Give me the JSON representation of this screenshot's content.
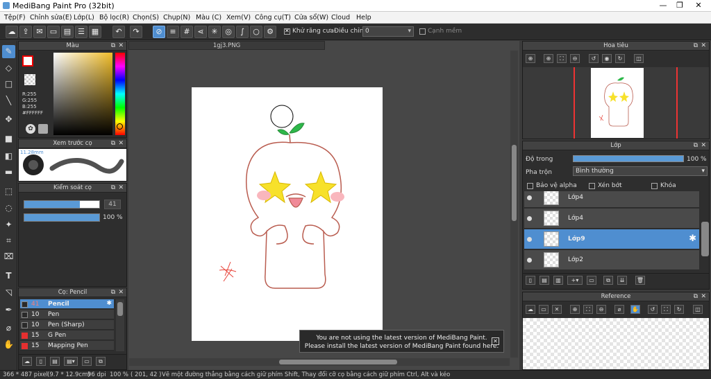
{
  "window": {
    "title": "MediBang Paint Pro (32bit)",
    "minimize": "—",
    "maximize": "❐",
    "close": "✕"
  },
  "menu": [
    "Tệp(F)",
    "Chỉnh sửa(E)",
    "Lớp(L)",
    "Bộ lọc(R)",
    "Chọn(S)",
    "Chụp(N)",
    "Màu (C)",
    "Xem(V)",
    "Công cụ(T)",
    "Cửa sổ(W)",
    "Cloud",
    "Help"
  ],
  "toolbar": {
    "antialias_label": "Khử răng cưa",
    "adjust_label": "Điều chỉnh",
    "adjust_value": "0",
    "smooth_edge_label": "Cạnh mềm"
  },
  "color_panel": {
    "title": "Màu",
    "r": "R:255",
    "g": "G:255",
    "b": "B:255",
    "hex": "#FFFFFF",
    "primary": "#ffffff",
    "secondary": "#ffffff"
  },
  "brush_preview": {
    "title": "Xem trước cọ",
    "size_label": "11.28mm"
  },
  "brush_control": {
    "title": "Kiểm soát cọ",
    "size": "41",
    "size_fraction": 0.74,
    "opacity": "100 %"
  },
  "brush_list": {
    "title": "Cọ: Pencil",
    "items": [
      {
        "size": "41",
        "name": "Pencil",
        "color": "#2a2a2a",
        "selected": true
      },
      {
        "size": "10",
        "name": "Pen",
        "color": "#2a2a2a",
        "selected": false
      },
      {
        "size": "10",
        "name": "Pen (Sharp)",
        "color": "#2a2a2a",
        "selected": false
      },
      {
        "size": "15",
        "name": "G Pen",
        "color": "#e53030",
        "selected": false
      },
      {
        "size": "15",
        "name": "Mapping Pen",
        "color": "#e53030",
        "selected": false
      }
    ]
  },
  "document": {
    "tab_label": "1gj3.PNG"
  },
  "navigator": {
    "title": "Hoa tiêu"
  },
  "layer_panel": {
    "title": "Lớp",
    "opacity_label": "Độ trong",
    "opacity_value": "100 %",
    "blend_label": "Pha trộn",
    "blend_value": "Bình thường",
    "protect_alpha": "Bảo vệ alpha",
    "clipping": "Xén bớt",
    "lock": "Khóa",
    "layers": [
      {
        "name": "Lớp4",
        "selected": false
      },
      {
        "name": "Lớp4",
        "selected": false
      },
      {
        "name": "Lớp9",
        "selected": true
      },
      {
        "name": "Lớp2",
        "selected": false
      }
    ]
  },
  "reference_panel": {
    "title": "Reference"
  },
  "notice": {
    "line1": "You are not using the latest version of MediBang Paint.",
    "line2": "Please install the latest version of MediBang Paint found here."
  },
  "status": {
    "size": "366 * 487 pixel",
    "physical": "(9.7 * 12.9cm)",
    "dpi": "96 dpi",
    "zoom": "100 %",
    "coords": "( 201, 42 )",
    "hint": "Vẽ một đường thẳng bằng cách giữ phím Shift, Thay đổi cỡ cọ bằng cách giữ phím Ctrl, Alt và kéo"
  }
}
